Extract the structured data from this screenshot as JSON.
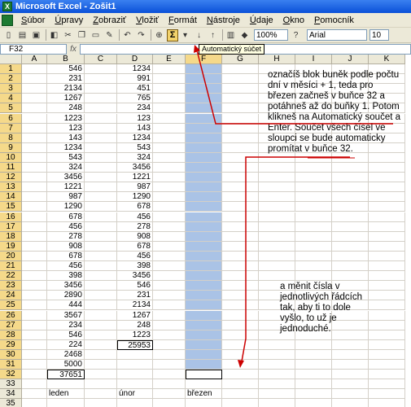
{
  "window": {
    "title": "Microsoft Excel - Zošit1"
  },
  "menu": [
    {
      "u": "S",
      "rest": "úbor"
    },
    {
      "u": "Ú",
      "rest": "pravy"
    },
    {
      "u": "Z",
      "rest": "obraziť"
    },
    {
      "u": "V",
      "rest": "ložiť"
    },
    {
      "u": "F",
      "rest": "ormát"
    },
    {
      "u": "N",
      "rest": "ástroje"
    },
    {
      "u": "Ú",
      "rest": "daje"
    },
    {
      "u": "O",
      "rest": "kno"
    },
    {
      "u": "P",
      "rest": "omocník"
    }
  ],
  "toolbar": {
    "zoom": "100%",
    "font": "Arial",
    "font_size": "10",
    "sigma": "Σ",
    "tooltip": "Automatický súčet"
  },
  "formula_bar": {
    "name_box": "F32",
    "fx": "fx",
    "value": ""
  },
  "columns": [
    "A",
    "B",
    "C",
    "D",
    "E",
    "F",
    "G",
    "H",
    "I",
    "J",
    "K"
  ],
  "rows": [
    "1",
    "2",
    "3",
    "4",
    "5",
    "6",
    "7",
    "8",
    "9",
    "10",
    "11",
    "12",
    "13",
    "14",
    "15",
    "16",
    "17",
    "18",
    "19",
    "20",
    "21",
    "22",
    "23",
    "24",
    "25",
    "26",
    "27",
    "28",
    "29",
    "30",
    "31",
    "32",
    "33",
    "34",
    "35"
  ],
  "col_B": [
    "546",
    "231",
    "2134",
    "1267",
    "248",
    "1223",
    "123",
    "143",
    "1234",
    "543",
    "324",
    "3456",
    "1221",
    "987",
    "1290",
    "678",
    "456",
    "278",
    "908",
    "678",
    "456",
    "398",
    "3456",
    "2890",
    "444",
    "3567",
    "234",
    "546",
    "224",
    "2468",
    "5000",
    "37651"
  ],
  "col_D": [
    "1234",
    "991",
    "451",
    "765",
    "234",
    "123",
    "143",
    "1234",
    "543",
    "324",
    "3456",
    "1221",
    "987",
    "1290",
    "678",
    "456",
    "278",
    "908",
    "678",
    "456",
    "398",
    "3456",
    "546",
    "231",
    "2134",
    "1267",
    "248",
    "1223",
    "25953"
  ],
  "labels_row34": {
    "b": "leden",
    "d": "únor",
    "f": "březen"
  },
  "note_top": [
    "označíš blok buněk podle počtu",
    "dní v měsíci  + 1, teda pro",
    "březen začneš v buňce 32 a",
    "potáhneš až do  buňky 1. Potom",
    "klikneš na Automatický součet a",
    "Enter. Součet všech čísel ve",
    "sloupci se bude automaticky",
    "promítat v  buňce 32."
  ],
  "note_bottom": [
    "a měnit čísla v",
    "jednotlivých řádcích",
    "tak, aby ti to dole",
    "vyšlo, to už je",
    "jednoduché."
  ],
  "colors": {
    "selection": "#aac3e6",
    "annotation": "#cc0000",
    "title_bar": "#0a50d8"
  }
}
